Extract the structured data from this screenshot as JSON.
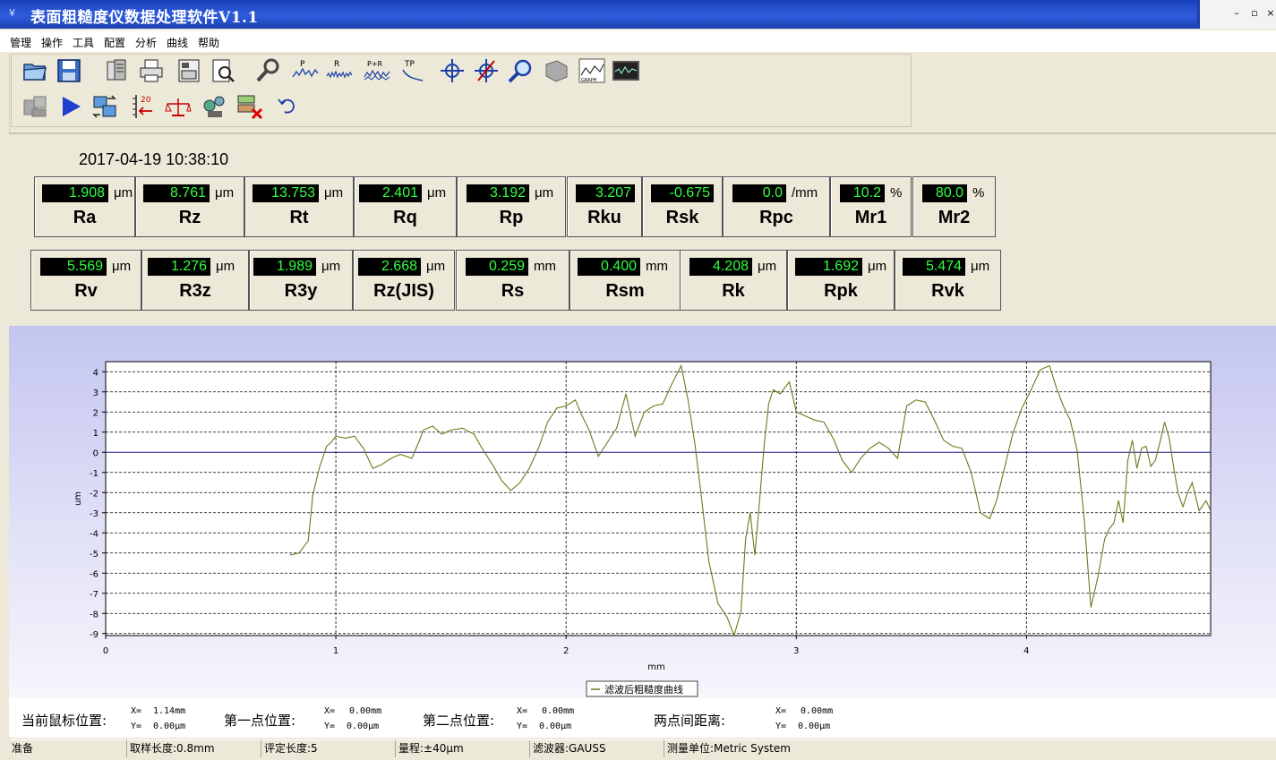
{
  "window": {
    "title": "表面粗糙度仪数据处理软件V1.1",
    "controls": [
      "–",
      "▫",
      "×"
    ]
  },
  "menu": [
    "管理",
    "操作",
    "工具",
    "配置",
    "分析",
    "曲线",
    "帮助"
  ],
  "toolbar": {
    "row1": [
      "open-folder-icon",
      "save-icon",
      "database-icon",
      "print-icon",
      "print-setup-icon",
      "print-preview-icon",
      "wrench-icon",
      "profile-p-icon",
      "profile-r-icon",
      "profile-pr-icon",
      "profile-tp-icon",
      "crosshair-icon",
      "crosshair-cut-icon",
      "zoom-icon",
      "eraser-icon",
      "graph-icon",
      "oscilloscope-icon"
    ],
    "row1_labels": {
      "p": "P",
      "r": "R",
      "pr": "P+R",
      "tp": "TP",
      "graph": "GRAPH"
    },
    "row2": [
      "measure-icon",
      "run-icon",
      "transfer-icon",
      "scale-icon",
      "balance-icon",
      "robot-icon",
      "network-delete-icon",
      "undo-icon"
    ],
    "row2_labels": {
      "scale": "20"
    }
  },
  "datetime": "2017-04-19 10:38:10",
  "params_row1": [
    {
      "value": "1.908",
      "unit": "μm",
      "name": "Ra"
    },
    {
      "value": "8.761",
      "unit": "μm",
      "name": "Rz"
    },
    {
      "value": "13.753",
      "unit": "μm",
      "name": "Rt"
    },
    {
      "value": "2.401",
      "unit": "μm",
      "name": "Rq"
    },
    {
      "value": "3.192",
      "unit": "μm",
      "name": "Rp"
    },
    {
      "value": "3.207",
      "unit": "",
      "name": "Rku"
    },
    {
      "value": "-0.675",
      "unit": "",
      "name": "Rsk"
    },
    {
      "value": "0.0",
      "unit": "/mm",
      "name": "Rpc"
    },
    {
      "value": "10.2",
      "unit": "%",
      "name": "Mr1"
    },
    {
      "value": "80.0",
      "unit": "%",
      "name": "Mr2"
    }
  ],
  "params_row2": [
    {
      "value": "5.569",
      "unit": "μm",
      "name": "Rv"
    },
    {
      "value": "1.276",
      "unit": "μm",
      "name": "R3z"
    },
    {
      "value": "1.989",
      "unit": "μm",
      "name": "R3y"
    },
    {
      "value": "2.668",
      "unit": "μm",
      "name": "Rz(JIS)"
    },
    {
      "value": "0.259",
      "unit": "mm",
      "name": "Rs"
    },
    {
      "value": "0.400",
      "unit": "mm",
      "name": "Rsm"
    },
    {
      "value": "4.208",
      "unit": "μm",
      "name": "Rk"
    },
    {
      "value": "1.692",
      "unit": "μm",
      "name": "Rpk"
    },
    {
      "value": "5.474",
      "unit": "μm",
      "name": "Rvk"
    }
  ],
  "chart_data": {
    "type": "line",
    "xlabel": "mm",
    "ylabel": "um",
    "xlim": [
      0,
      4.8
    ],
    "ylim": [
      -9.1,
      4.5
    ],
    "xticks": [
      0,
      1,
      2,
      3,
      4
    ],
    "yticks": [
      4,
      3,
      2,
      1,
      0,
      -1,
      -2,
      -3,
      -4,
      -5,
      -6,
      -7,
      -8,
      -9
    ],
    "grid": true,
    "legend_position": "bottom-center",
    "series": [
      {
        "name": "滤波后粗糙度曲线",
        "color": "#6b7a1a",
        "x": [
          0.8,
          0.84,
          0.88,
          0.9,
          0.93,
          0.96,
          0.98,
          1.0,
          1.04,
          1.08,
          1.12,
          1.16,
          1.2,
          1.24,
          1.28,
          1.33,
          1.36,
          1.38,
          1.42,
          1.46,
          1.5,
          1.55,
          1.6,
          1.64,
          1.68,
          1.72,
          1.76,
          1.8,
          1.84,
          1.88,
          1.92,
          1.96,
          2.0,
          2.04,
          2.07,
          2.1,
          2.14,
          2.18,
          2.22,
          2.26,
          2.3,
          2.34,
          2.38,
          2.42,
          2.46,
          2.5,
          2.53,
          2.56,
          2.59,
          2.62,
          2.66,
          2.7,
          2.73,
          2.76,
          2.78,
          2.8,
          2.82,
          2.84,
          2.86,
          2.88,
          2.9,
          2.93,
          2.97,
          3.0,
          3.04,
          3.08,
          3.12,
          3.16,
          3.2,
          3.24,
          3.28,
          3.32,
          3.36,
          3.4,
          3.44,
          3.48,
          3.52,
          3.56,
          3.6,
          3.64,
          3.68,
          3.72,
          3.76,
          3.8,
          3.84,
          3.87,
          3.9,
          3.94,
          3.98,
          4.02,
          4.06,
          4.1,
          4.13,
          4.16,
          4.19,
          4.22,
          4.25,
          4.28,
          4.31,
          4.34,
          4.36,
          4.38,
          4.4,
          4.42,
          4.44,
          4.46,
          4.48,
          4.5,
          4.52,
          4.54,
          4.56,
          4.58,
          4.6,
          4.62,
          4.64,
          4.66,
          4.68,
          4.7,
          4.72,
          4.75,
          4.78,
          4.8
        ],
        "y": [
          -5.1,
          -5.0,
          -4.4,
          -2.1,
          -0.7,
          0.3,
          0.5,
          0.8,
          0.7,
          0.8,
          0.2,
          -0.8,
          -0.6,
          -0.3,
          -0.1,
          -0.3,
          0.5,
          1.1,
          1.3,
          0.9,
          1.1,
          1.2,
          0.9,
          0.1,
          -0.6,
          -1.4,
          -1.9,
          -1.5,
          -0.8,
          0.2,
          1.5,
          2.2,
          2.3,
          2.6,
          1.8,
          1.1,
          -0.2,
          0.5,
          1.2,
          2.9,
          0.8,
          2.0,
          2.3,
          2.4,
          3.4,
          4.3,
          2.6,
          0.4,
          -2.4,
          -5.4,
          -7.5,
          -8.2,
          -9.1,
          -7.9,
          -4.3,
          -3.0,
          -5.1,
          -2.5,
          0.3,
          2.4,
          3.1,
          2.9,
          3.5,
          2.0,
          1.8,
          1.6,
          1.5,
          0.7,
          -0.4,
          -1.0,
          -0.3,
          0.2,
          0.5,
          0.2,
          -0.3,
          2.3,
          2.6,
          2.5,
          1.6,
          0.6,
          0.3,
          0.2,
          -1.0,
          -3.0,
          -3.3,
          -2.4,
          -1.0,
          0.9,
          2.2,
          3.1,
          4.1,
          4.3,
          3.2,
          2.3,
          1.6,
          0.1,
          -3.2,
          -7.7,
          -6.2,
          -4.3,
          -3.8,
          -3.5,
          -2.4,
          -3.5,
          -0.4,
          0.6,
          -0.8,
          0.2,
          0.3,
          -0.7,
          -0.4,
          0.5,
          1.5,
          0.7,
          -0.8,
          -2.1,
          -2.7,
          -2.0,
          -1.5,
          -2.9,
          -2.4,
          -2.9
        ]
      }
    ]
  },
  "cursor_info": {
    "current_label": "当前鼠标位置:",
    "current_x": "1.14mm",
    "current_y": "0.00μm",
    "first_label": "第一点位置:",
    "first_x": "0.00mm",
    "first_y": "0.00μm",
    "second_label": "第二点位置:",
    "second_x": "0.00mm",
    "second_y": "0.00μm",
    "distance_label": "两点间距离:",
    "distance_x": "0.00mm",
    "distance_y": "0.00μm",
    "x_prefix": "X=",
    "y_prefix": "Y="
  },
  "statusbar": [
    "准备",
    "取样长度:0.8mm",
    "评定长度:5",
    "量程:±40μm",
    "滤波器:GAUSS",
    "测量单位:Metric System"
  ]
}
